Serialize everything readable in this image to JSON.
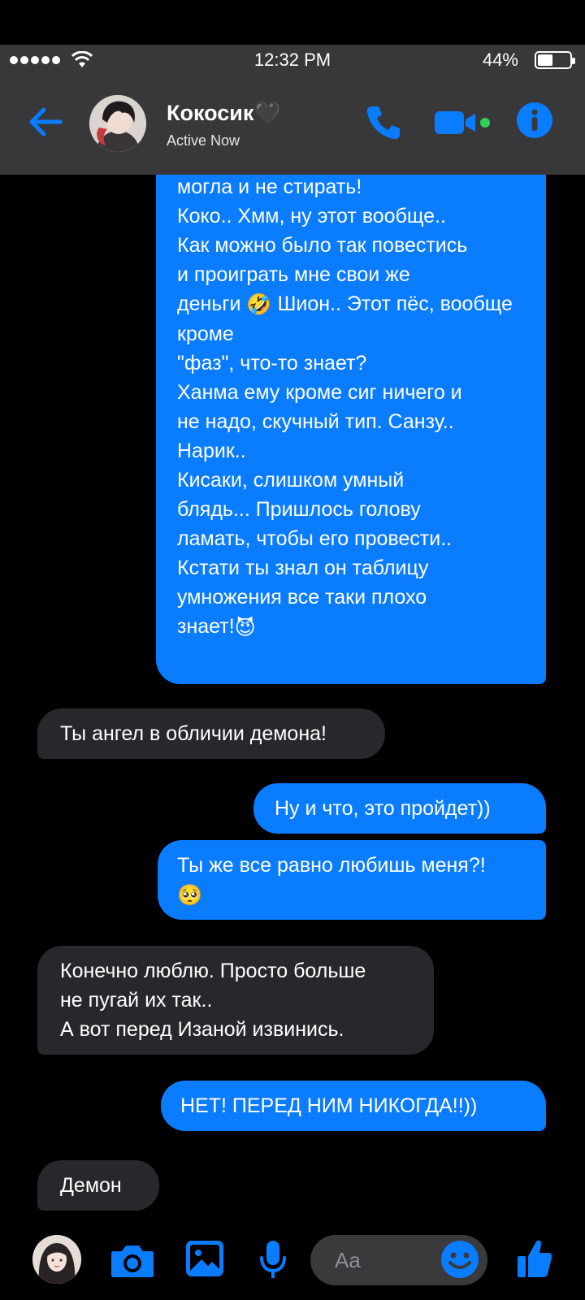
{
  "status_bar": {
    "time": "12:32 PM",
    "battery": "44%"
  },
  "header": {
    "contact_name": "Кокосик🖤",
    "contact_status": "Active Now",
    "icons": {
      "back": "back-arrow-icon",
      "phone": "phone-icon",
      "video": "video-camera-icon",
      "info": "info-icon"
    }
  },
  "messages": [
    {
      "direction": "out",
      "text": "могла и не стирать!\nКоко.. Хмм, ну этот вообще..\nКак можно было так повестись\nи проиграть мне свои же\nденьги",
      "emoji": "🤣",
      "text2": "Шион.. Этот пёс, вообще кроме\n\"фаз\", что-то знает?\nХанма ему кроме сиг ничего и\nне надо, скучный тип. Санзу..\nНарик..\nКисаки, слишком умный\nблядь... Пришлось голову\nламать, чтобы его провести..\nКстати ты знал он таблицу\nумножения все таки плохо\nзнает!",
      "emoji2": "😈"
    },
    {
      "direction": "in",
      "text": "Ты ангел в обличии демона!"
    },
    {
      "direction": "out",
      "text": "Ну и что, это пройдет))"
    },
    {
      "direction": "out",
      "text": "Ты же все равно любишь меня?!",
      "emoji": "🥺"
    },
    {
      "direction": "in",
      "text": "Конечно люблю. Просто больше\nне пугай их так..\nА вот перед Изаной извинись."
    },
    {
      "direction": "out",
      "text": "НЕТ! ПЕРЕД НИМ НИКОГДА!!))"
    },
    {
      "direction": "in",
      "text": "Демон"
    }
  ],
  "composer": {
    "placeholder": "Aa",
    "icons": {
      "camera": "camera-icon",
      "gallery": "image-icon",
      "mic": "microphone-icon",
      "emoji": "smiley-icon",
      "like": "thumbs-up-icon"
    }
  },
  "colors": {
    "accent": "#0a7cff",
    "incoming_bubble": "#28272b",
    "header_bg": "#38383a",
    "active_dot": "#30d158"
  }
}
